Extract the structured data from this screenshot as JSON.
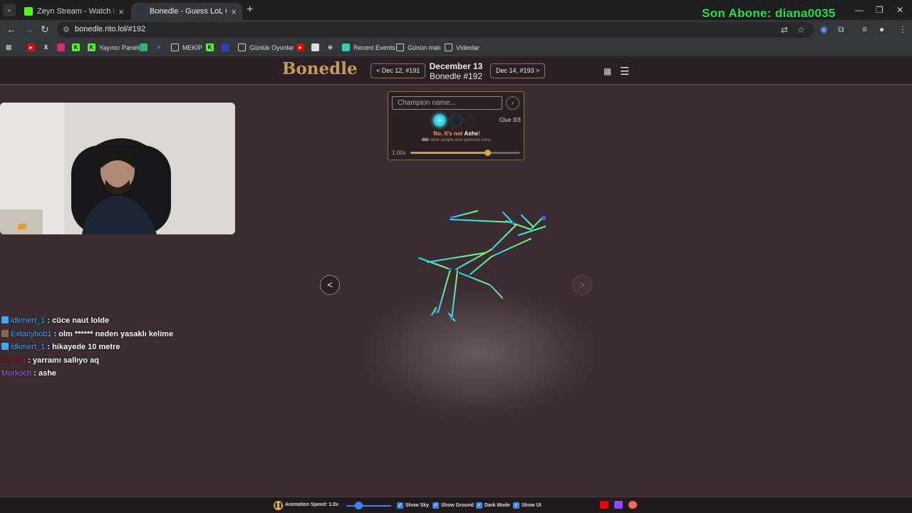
{
  "browser": {
    "tabs": [
      {
        "title": "Zeyn Stream - Watch Live on K",
        "active": false
      },
      {
        "title": "Bonedle - Guess LoL Champion",
        "active": true
      }
    ],
    "url": "bonedle.rito.lol/#192",
    "bookmarks": [
      "Yayıncı Paneli",
      "MEKİP",
      "Günlük Oyunlar",
      "Recent Events",
      "Günün malı",
      "Videolar"
    ]
  },
  "overlay": {
    "sub_banner": "Son Abone: diana0035"
  },
  "site": {
    "logo": "Bonedle",
    "prev_day": "< Dec 12, #191",
    "next_day": "Dec 14, #193 >",
    "date": "December 13",
    "puzzle": "Bonedle #192"
  },
  "panel": {
    "placeholder": "Champion name...",
    "submit_icon": "›",
    "clue": "Clue 3/3",
    "result_prefix": "No, it's not ",
    "result_name": "Ashe",
    "result_suffix": "!",
    "others_count": "466",
    "others_text": " other people also guessed Ashe.",
    "speed_label": "1.00x",
    "speed_fraction": 0.7
  },
  "stage": {
    "prev_arrow": "<",
    "next_arrow": ">"
  },
  "chat": [
    {
      "user": "idkmert_1",
      "message": " : cüce naut lolde",
      "color": "#3fa9f5"
    },
    {
      "user": "Extacybob1",
      "message": " : olm ****** neden yasaklı kelime",
      "color": "#3fa9f5"
    },
    {
      "user": "idkmert_1",
      "message": " : hikayede 10 metre",
      "color": "#3fa9f5"
    },
    {
      "user": "Freeva",
      "message": " : yarraını sallıyo aq",
      "color": "#c0102a"
    },
    {
      "user": "Morkoch",
      "message": " : ashe",
      "color": "#b05cf0"
    }
  ],
  "bottom_bar": {
    "animation_speed": "Animation Speed: 1.0x",
    "animation_speed_fraction": 0.27,
    "show_sky": "Show Sky",
    "show_ground": "Show Ground",
    "dark_mode": "Dark Mode",
    "show_ui": "Show UI"
  },
  "colors": {
    "accent": "#c59a5d",
    "background": "#3a2c30",
    "header": "#2a1f23",
    "checkbox": "#3b82f6",
    "sub_banner": "#19e64a"
  }
}
